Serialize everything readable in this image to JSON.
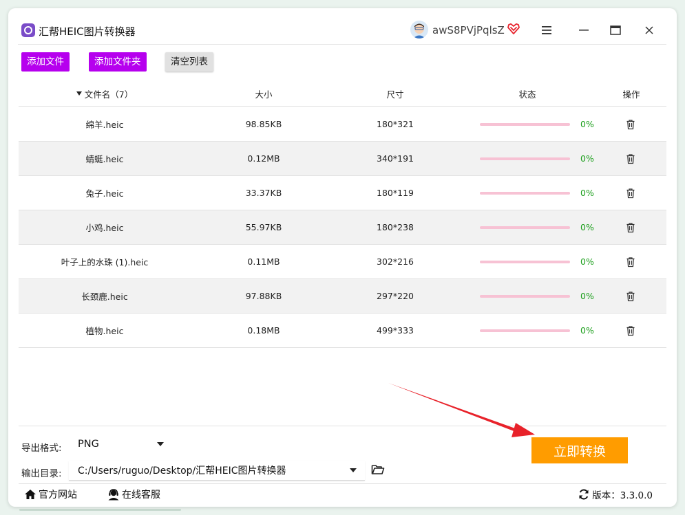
{
  "app": {
    "title": "汇帮HEIC图片转换器",
    "username": "awS8PVjPqlsZ"
  },
  "toolbar": {
    "add_file": "添加文件",
    "add_folder": "添加文件夹",
    "clear_list": "清空列表"
  },
  "table": {
    "headers": {
      "name": "文件名（7）",
      "size": "大小",
      "dimensions": "尺寸",
      "status": "状态",
      "actions": "操作"
    },
    "rows": [
      {
        "name": "绵羊.heic",
        "size": "98.85KB",
        "dimensions": "180*321",
        "progress": 0,
        "percent": "0%"
      },
      {
        "name": "蜻蜓.heic",
        "size": "0.12MB",
        "dimensions": "340*191",
        "progress": 0,
        "percent": "0%"
      },
      {
        "name": "兔子.heic",
        "size": "33.37KB",
        "dimensions": "180*119",
        "progress": 0,
        "percent": "0%"
      },
      {
        "name": "小鸡.heic",
        "size": "55.97KB",
        "dimensions": "180*238",
        "progress": 0,
        "percent": "0%"
      },
      {
        "name": "叶子上的水珠 (1).heic",
        "size": "0.11MB",
        "dimensions": "302*216",
        "progress": 0,
        "percent": "0%"
      },
      {
        "name": "长颈鹿.heic",
        "size": "97.88KB",
        "dimensions": "297*220",
        "progress": 0,
        "percent": "0%"
      },
      {
        "name": "植物.heic",
        "size": "0.18MB",
        "dimensions": "499*333",
        "progress": 0,
        "percent": "0%"
      }
    ]
  },
  "output": {
    "format_label": "导出格式:",
    "format_value": "PNG",
    "dir_label": "输出目录:",
    "dir_value": "C:/Users/ruguo/Desktop/汇帮HEIC图片转换器"
  },
  "convert_button": "立即转换",
  "footer": {
    "website": "官方网站",
    "support": "在线客服",
    "version": "版本：3.3.0.0"
  },
  "colors": {
    "accent_purple": "#b600ee",
    "convert_orange": "#ff9c00",
    "progress_track": "#f7c2d4",
    "percent_green": "#1a9e1a",
    "annotation_arrow": "#e8222a"
  },
  "icons": {
    "logo": "app-logo-icon",
    "vip": "vip-diamond-icon",
    "menu": "hamburger-menu-icon",
    "minimize": "minimize-icon",
    "maximize": "maximize-icon",
    "close": "close-icon",
    "delete": "trash-icon",
    "folder": "folder-open-icon",
    "home": "home-icon",
    "support": "headset-icon",
    "refresh": "refresh-icon"
  }
}
